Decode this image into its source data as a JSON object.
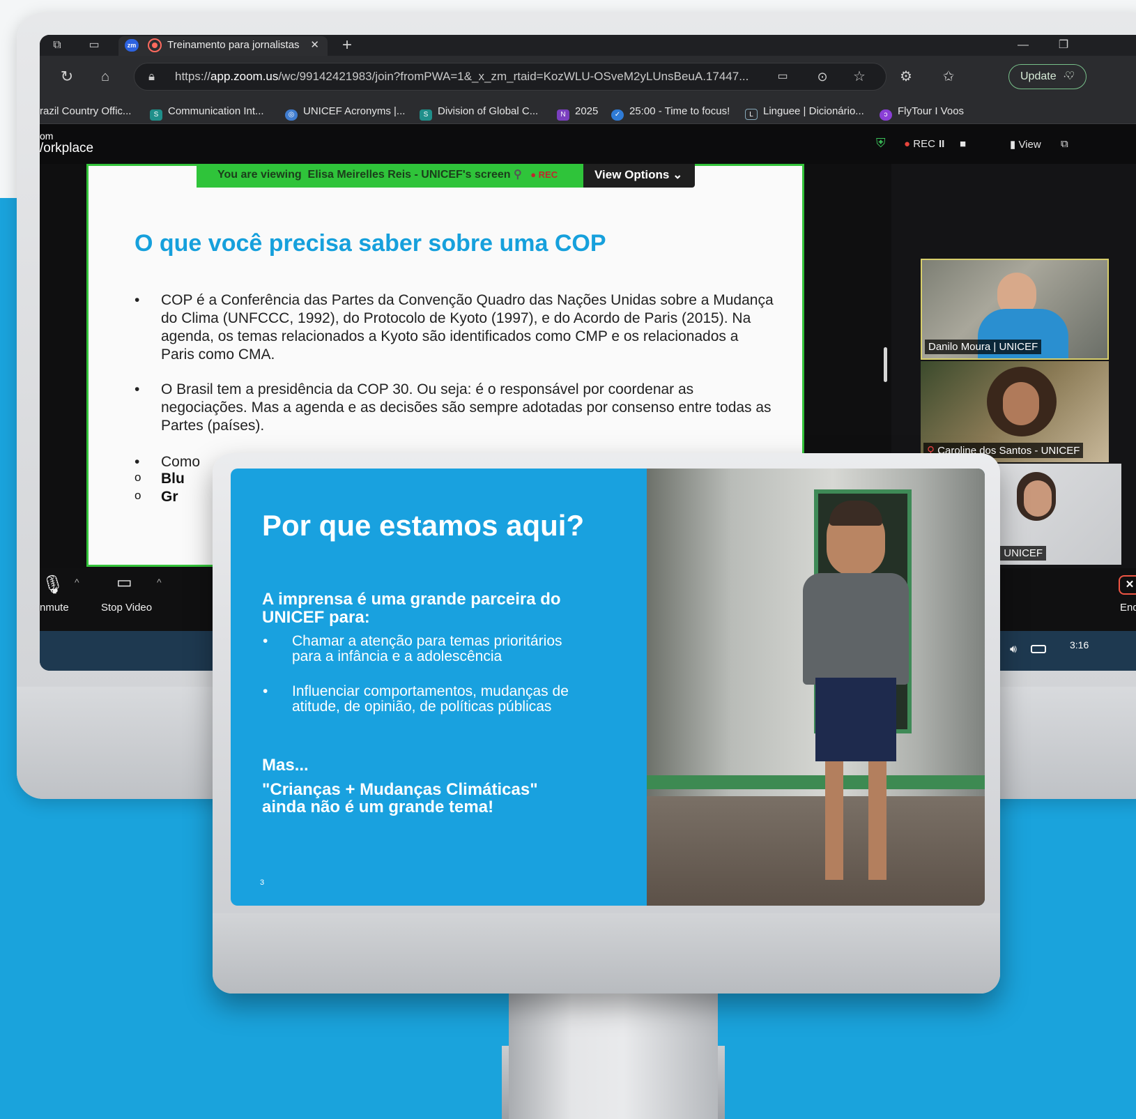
{
  "browser": {
    "tab_title": "Treinamento para jornalistas",
    "tab_close": "✕",
    "new_tab": "+",
    "url_prefix": "https://",
    "url_host": "app.zoom.us",
    "url_rest": "/wc/99142421983/join?fromPWA=1&_x_zm_rtaid=KozWLU-OSveM2yLUnsBeuA.17447...",
    "update_label": "Update",
    "bookmarks": [
      {
        "label": "razil Country Offic...",
        "icon": "sharepoint-icon"
      },
      {
        "label": "Communication Int...",
        "icon": "sharepoint-icon"
      },
      {
        "label": "UNICEF Acronyms |...",
        "icon": "globe-icon"
      },
      {
        "label": "Division of Global C...",
        "icon": "sharepoint-icon"
      },
      {
        "label": "2025",
        "icon": "onenote-icon"
      },
      {
        "label": "25:00 - Time to focus!",
        "icon": "check-icon"
      },
      {
        "label": "Linguee | Dicionário...",
        "icon": "linguee-icon"
      },
      {
        "label": "FlyTour I Voos",
        "icon": "flytour-icon"
      }
    ]
  },
  "zoom": {
    "brand_top": "om",
    "brand": "/orkplace",
    "rec": "REC",
    "pause": "II",
    "view": "View",
    "viewing_prefix": "You are viewing",
    "viewing_name": "Elisa Meirelles Reis - UNICEF's screen",
    "viewing_rec": "REC",
    "view_options": "View Options",
    "participants": [
      {
        "name": "Danilo Moura | UNICEF"
      },
      {
        "name": "Caroline dos Santos - UNICEF"
      },
      {
        "name": "Buoro | UNICEF"
      }
    ],
    "toolbar": {
      "unmute": "nmute",
      "stop_video": "Stop Video",
      "end": "End"
    },
    "taskbar_time": "3:16"
  },
  "shared_slide": {
    "title": "O que você precisa saber sobre uma COP",
    "bullets": [
      "COP é a Conferência das Partes da Convenção Quadro das Nações Unidas sobre a Mudança do Clima (UNFCCC, 1992), do Protocolo de Kyoto (1997), e do Acordo de Paris (2015). Na agenda, os temas relacionados a Kyoto são identificados como CMP e os relacionados a Paris como CMA.",
      "O Brasil tem a presidência da COP 30. Ou seja: é o responsável por coordenar as negociações. Mas a agenda e as decisões são sempre adotadas por consenso entre todas as Partes (países).",
      "Como"
    ],
    "sub_bullets": [
      "Blu",
      "Gr"
    ]
  },
  "front_slide": {
    "title": "Por que estamos aqui?",
    "subtitle": "A imprensa é uma grande parceira do UNICEF para:",
    "bullets": [
      "Chamar a atenção para temas prioritários para a infância e a adolescência",
      "Influenciar comportamentos, mudanças de atitude, de opinião, de políticas públicas"
    ],
    "mas": "Mas...",
    "quote": "\"Crianças + Mudanças Climáticas\"  ainda não é um grande tema!",
    "page": "3"
  },
  "colors": {
    "accent_blue": "#1aa3dc",
    "zoom_green": "#2fc43a",
    "slide_title_blue": "#16a0dc"
  }
}
